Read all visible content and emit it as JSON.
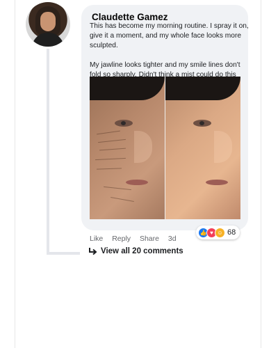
{
  "comment": {
    "author": "Claudette Gamez",
    "paragraph1": "This has become my morning routine. I spray it on, give it a moment, and my whole face looks more sculpted.",
    "paragraph2": "My jawline looks tighter and my smile lines don't fold so sharply. Didn't think a mist could do this much"
  },
  "actions": {
    "like": "Like",
    "reply": "Reply",
    "share": "Share",
    "time": "3d"
  },
  "reactions": {
    "count": "68",
    "icons": [
      "like-icon",
      "love-icon",
      "care-icon"
    ]
  },
  "view_all": {
    "label": "View all 20 comments"
  }
}
